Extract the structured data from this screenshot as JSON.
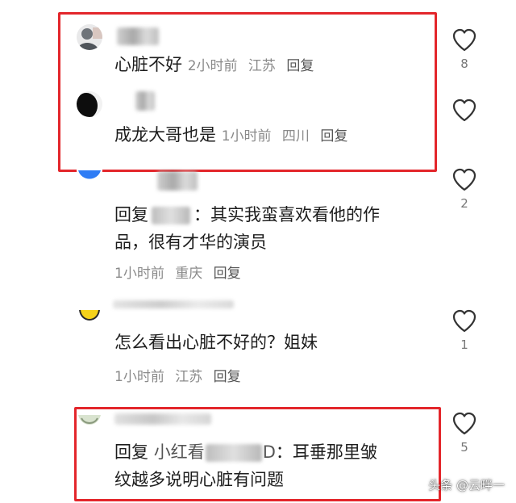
{
  "comments": [
    {
      "text": "心脏不好",
      "time": "2小时前",
      "location": "江苏",
      "reply_label": "回复",
      "likes": "8"
    },
    {
      "text": "成龙大哥也是",
      "time": "1小时前",
      "location": "四川",
      "reply_label": "回复",
      "likes": ""
    },
    {
      "prefix": "回复",
      "line1": "：其实我蛮喜欢看他的作",
      "line2": "品，很有才华的演员",
      "time": "1小时前",
      "location": "重庆",
      "reply_label": "回复",
      "likes": "2"
    },
    {
      "text": "怎么看出心脏不好的？姐妹",
      "time": "1小时前",
      "location": "江苏",
      "reply_label": "回复",
      "likes": "1"
    },
    {
      "prefix": "回复",
      "mention": "小红看",
      "mention_suffix": "D",
      "line1": "：耳垂那里皱",
      "line2": "纹越多说明心脏有问题",
      "likes": "5"
    }
  ],
  "watermark": "头条 @云畔一",
  "colors": {
    "highlight": "#e3262b",
    "meta": "#8a8a8a",
    "text": "#1d1d1d"
  },
  "icons": {
    "like": "heart-outline-icon"
  }
}
